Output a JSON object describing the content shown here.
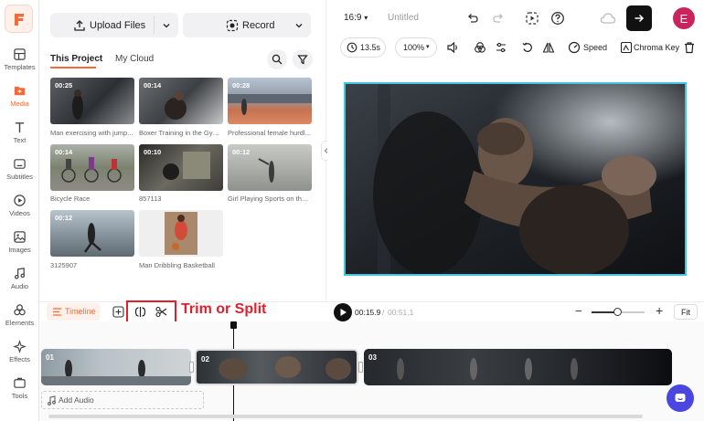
{
  "sidebar": {
    "items": [
      {
        "label": "Templates",
        "icon": "templates-icon"
      },
      {
        "label": "Media",
        "icon": "media-icon"
      },
      {
        "label": "Text",
        "icon": "text-icon"
      },
      {
        "label": "Subtitles",
        "icon": "subtitles-icon"
      },
      {
        "label": "Videos",
        "icon": "videos-icon"
      },
      {
        "label": "Images",
        "icon": "images-icon"
      },
      {
        "label": "Audio",
        "icon": "audio-icon"
      },
      {
        "label": "Elements",
        "icon": "elements-icon"
      },
      {
        "label": "Effects",
        "icon": "effects-icon"
      },
      {
        "label": "Tools",
        "icon": "tools-icon"
      }
    ],
    "active": "Media",
    "accent": "#f26b3a"
  },
  "media": {
    "upload_label": "Upload Files",
    "record_label": "Record",
    "tabs": [
      "This Project",
      "My Cloud"
    ],
    "active_tab": "This Project",
    "items": [
      {
        "duration": "00:25",
        "caption": "Man exercising with jump..."
      },
      {
        "duration": "00:14",
        "caption": "Boxer Training in the Gym..."
      },
      {
        "duration": "00:28",
        "caption": "Professional female hurdl..."
      },
      {
        "duration": "00:14",
        "caption": "Bicycle Race"
      },
      {
        "duration": "00:10",
        "caption": "857113"
      },
      {
        "duration": "00:12",
        "caption": "Girl Playing Sports on the ..."
      },
      {
        "duration": "00:12",
        "caption": "3125907"
      },
      {
        "duration": "",
        "caption": "Man Dribbling Basketball"
      }
    ]
  },
  "topbar": {
    "aspect": "16:9",
    "title": "Untitled",
    "avatar_letter": "E"
  },
  "toolbar": {
    "duration": "13.5s",
    "zoom": "100%",
    "speed_label": "Speed",
    "chroma_label": "Chroma Key"
  },
  "timeline": {
    "label": "Timeline",
    "annotation": "Trim or Split",
    "current_time": "00:15.9",
    "separator": "/",
    "total_time": "00:51.1",
    "fit_label": "Fit",
    "add_audio_label": "Add Audio",
    "clips": [
      "01",
      "02",
      "03"
    ]
  }
}
